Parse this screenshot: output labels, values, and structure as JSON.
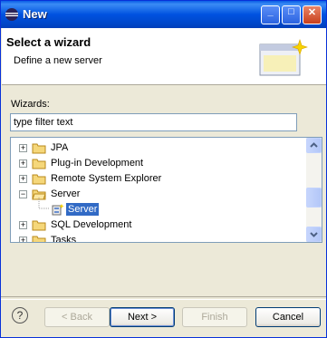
{
  "window": {
    "title": "New",
    "controls": {
      "minimize": "_",
      "maximize": "□",
      "close": "✕"
    }
  },
  "header": {
    "title": "Select a wizard",
    "description": "Define a new server"
  },
  "wizards": {
    "label": "Wizards:",
    "filter_value": "type filter text"
  },
  "tree": {
    "items": [
      {
        "label": "JPA",
        "expander": "+",
        "icon": "folder-icon"
      },
      {
        "label": "Plug-in Development",
        "expander": "+",
        "icon": "folder-icon"
      },
      {
        "label": "Remote System Explorer",
        "expander": "+",
        "icon": "folder-icon"
      },
      {
        "label": "Server",
        "expander": "−",
        "icon": "folder-open-icon"
      },
      {
        "label": "Server",
        "icon": "server-wizard-icon",
        "selected": true
      },
      {
        "label": "SQL Development",
        "expander": "+",
        "icon": "folder-icon"
      },
      {
        "label": "Tasks",
        "expander": "+",
        "icon": "folder-icon"
      }
    ]
  },
  "buttons": {
    "help": "?",
    "back": "< Back",
    "next": "Next >",
    "finish": "Finish",
    "cancel": "Cancel"
  },
  "colors": {
    "titlebar": "#0052e0",
    "selection": "#316ac5",
    "dialog_bg": "#ece9d8"
  }
}
